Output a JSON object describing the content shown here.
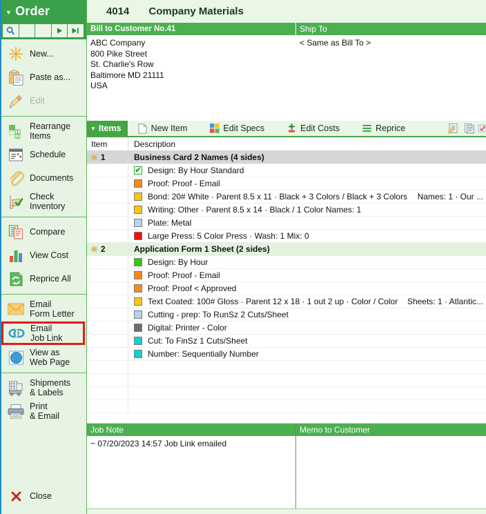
{
  "sidebar": {
    "title": "Order",
    "nav_buttons": [
      {
        "name": "search",
        "icon": "magnifier-icon"
      },
      {
        "name": "blank1",
        "icon": ""
      },
      {
        "name": "blank2",
        "icon": ""
      },
      {
        "name": "next",
        "icon": "play-next-icon"
      },
      {
        "name": "last",
        "icon": "skip-last-icon"
      }
    ],
    "groups": [
      {
        "items": [
          {
            "label": "New...",
            "icon": "new-star-icon",
            "disabled": false,
            "highlighted": false
          },
          {
            "label": "Paste as...",
            "icon": "clipboard-paste-icon",
            "disabled": false,
            "highlighted": false
          },
          {
            "label": "Edit",
            "icon": "pencil-icon",
            "disabled": true,
            "highlighted": false
          }
        ]
      },
      {
        "items": [
          {
            "label": "Rearrange\nItems",
            "icon": "rearrange-items-icon",
            "disabled": false,
            "highlighted": false
          },
          {
            "label": "Schedule",
            "icon": "calendar-icon",
            "disabled": false,
            "highlighted": false
          },
          {
            "label": "Documents",
            "icon": "paperclip-icon",
            "disabled": false,
            "highlighted": false
          },
          {
            "label": "Check\nInventory",
            "icon": "inventory-cart-icon",
            "disabled": false,
            "highlighted": false
          }
        ]
      },
      {
        "items": [
          {
            "label": "Compare",
            "icon": "compare-docs-icon",
            "disabled": false,
            "highlighted": false
          },
          {
            "label": "View Cost",
            "icon": "bar-chart-icon",
            "disabled": false,
            "highlighted": false
          },
          {
            "label": "Reprice All",
            "icon": "refresh-page-icon",
            "disabled": false,
            "highlighted": false
          }
        ]
      },
      {
        "items": [
          {
            "label": "Email\nForm Letter",
            "icon": "envelope-icon",
            "disabled": false,
            "highlighted": false
          },
          {
            "label": "Email\nJob Link",
            "icon": "chain-link-icon",
            "disabled": false,
            "highlighted": true
          },
          {
            "label": "View as\nWeb Page",
            "icon": "globe-icon",
            "disabled": false,
            "highlighted": false
          }
        ]
      },
      {
        "items": [
          {
            "label": "Shipments\n& Labels",
            "icon": "shipment-labels-icon",
            "disabled": false,
            "highlighted": false
          },
          {
            "label": "Print\n& Email",
            "icon": "printer-icon",
            "disabled": false,
            "highlighted": false
          }
        ]
      }
    ],
    "close": {
      "label": "Close",
      "icon": "close-x-icon"
    }
  },
  "header": {
    "order_number": "4014",
    "order_name": "Company Materials"
  },
  "bill_to": {
    "header": "Bill to Customer No.41",
    "address": "ABC Company\n800 Pike Street\nSt. Charlie's Row\nBaltimore MD 21111\nUSA"
  },
  "ship_to": {
    "header": "Ship To",
    "address": "< Same as Bill To >"
  },
  "items_toolbar": {
    "tab_label": "Items",
    "buttons": [
      {
        "label": "New Item",
        "icon": "new-document-icon"
      },
      {
        "label": "Edit Specs",
        "icon": "color-squares-icon"
      },
      {
        "label": "Edit Costs",
        "icon": "plus-costs-icon"
      },
      {
        "label": "Reprice",
        "icon": "lines-icon"
      }
    ],
    "right_icons": [
      {
        "name": "notes-pencil-icon"
      },
      {
        "name": "copy-document-icon"
      },
      {
        "name": "edit-check-icon"
      }
    ]
  },
  "columns": {
    "item": "Item",
    "description": "Description"
  },
  "rows": [
    {
      "type": "group",
      "selected": true,
      "num": "1",
      "star": "✳",
      "desc": "Business Card   2 Names (4 sides)",
      "tail": ""
    },
    {
      "type": "spec",
      "swatch": "check",
      "swatch_color": "#ffffff",
      "desc": "Design: By Hour Standard",
      "tail": ""
    },
    {
      "type": "spec",
      "swatch": "solid",
      "swatch_color": "#f78c14",
      "desc": "Proof: Proof - Email",
      "tail": ""
    },
    {
      "type": "spec",
      "swatch": "solid",
      "swatch_color": "#fdc70c",
      "desc": "Bond: 20# White · Parent 8.5 x 11 · Black + 3 Colors / Black + 3 Colors",
      "tail": "Names: 1 · Our ..."
    },
    {
      "type": "spec",
      "swatch": "solid",
      "swatch_color": "#fdc70c",
      "desc": "Writing: Other · Parent 8.5 x 14 · Black / 1 Color        Names: 1",
      "tail": ""
    },
    {
      "type": "spec",
      "swatch": "solid",
      "swatch_color": "#b3d4f5",
      "desc": "Plate: Metal",
      "tail": ""
    },
    {
      "type": "spec",
      "swatch": "solid",
      "swatch_color": "#f50d0d",
      "desc": "Large Press: 5 Color Press · Wash: 1  Mix: 0",
      "tail": ""
    },
    {
      "type": "group",
      "selected": false,
      "num": "2",
      "star": "✳",
      "desc": "Application Form   1 Sheet (2 sides)",
      "tail": ""
    },
    {
      "type": "spec",
      "swatch": "solid",
      "swatch_color": "#2fcc0a",
      "desc": "Design: By Hour",
      "tail": ""
    },
    {
      "type": "spec",
      "swatch": "solid",
      "swatch_color": "#f78c14",
      "desc": "Proof: Proof - Email",
      "tail": ""
    },
    {
      "type": "spec",
      "swatch": "solid",
      "swatch_color": "#f78c14",
      "desc": "Proof: Proof <  Approved",
      "tail": ""
    },
    {
      "type": "spec",
      "swatch": "solid",
      "swatch_color": "#fdc70c",
      "desc": "Text Coated: 100# Gloss · Parent 12 x 18 · 1 out  2 up · Color / Color",
      "tail": "Sheets: 1 · Atlantic..."
    },
    {
      "type": "spec",
      "swatch": "solid",
      "swatch_color": "#b3d4f5",
      "desc": "Cutting - prep: To RunSz        2 Cuts/Sheet",
      "tail": ""
    },
    {
      "type": "spec",
      "swatch": "solid",
      "swatch_color": "#6e6e6e",
      "desc": "Digital: Printer - Color",
      "tail": ""
    },
    {
      "type": "spec",
      "swatch": "solid",
      "swatch_color": "#0dd4d4",
      "desc": "Cut: To FinSz         1 Cuts/Sheet",
      "tail": ""
    },
    {
      "type": "spec",
      "swatch": "solid",
      "swatch_color": "#0dd4d4",
      "desc": "Number: Sequentially Number",
      "tail": ""
    }
  ],
  "empty_row_count": 4,
  "job_note": {
    "header": "Job Note",
    "text": "~ 07/20/2023 14:57 Job Link emailed"
  },
  "memo_to_customer": {
    "header": "Memo to Customer",
    "text": ""
  },
  "colors": {
    "green_header": "#4caf50",
    "green_title": "#3aa04a",
    "sidebar_bg": "#e8f4e3",
    "highlight_red": "#e01b1b",
    "accent_blue": "#1d8bc4",
    "selected_row": "#d6d6d6",
    "alt_group_row": "#e3f2de"
  }
}
